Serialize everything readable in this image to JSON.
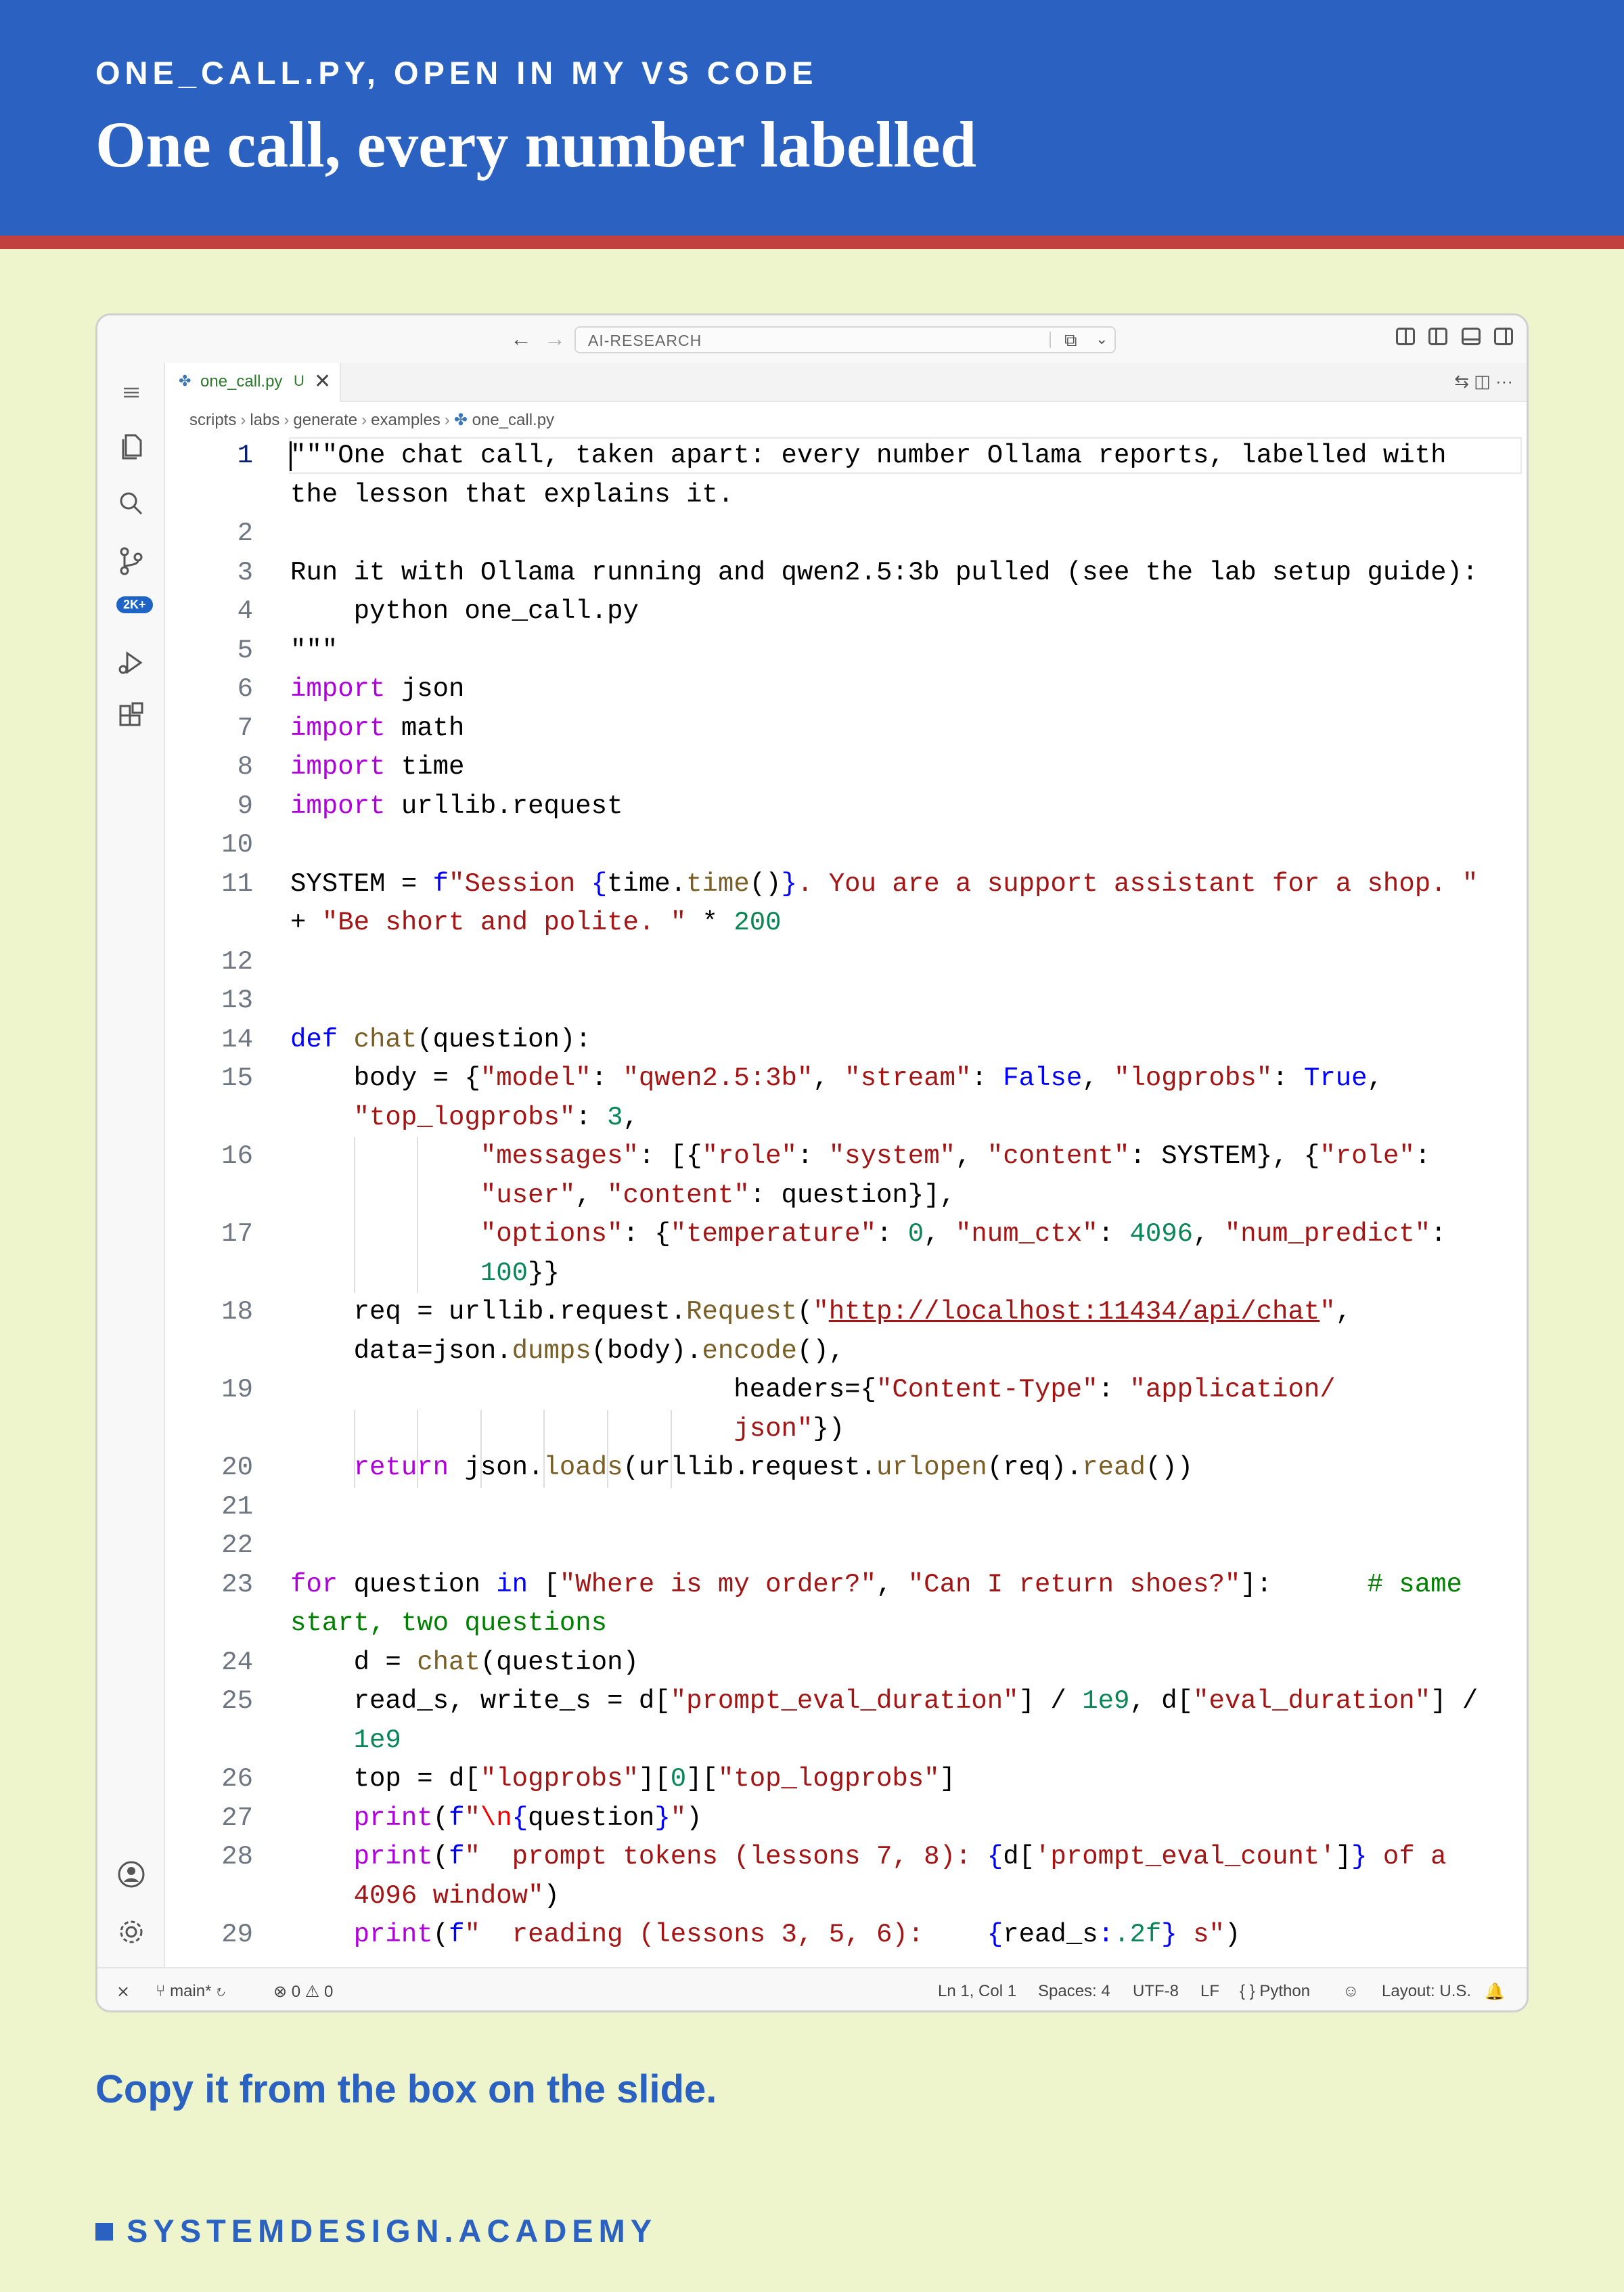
{
  "slide": {
    "kicker": "ONE_CALL.PY, OPEN IN MY VS CODE",
    "headline": "One call, every number labelled",
    "caption": "Copy it from the box on the slide.",
    "footer": "SYSTEMDESIGN.ACADEMY"
  },
  "titlebar": {
    "back": "←",
    "forward": "→",
    "search_text": "AI-RESEARCH",
    "chat": "⧉",
    "dropdown": "⌄"
  },
  "activity": {
    "scm_badge": "2K+"
  },
  "tab": {
    "file_icon": "✤",
    "name": "one_call.py",
    "modified": "U",
    "close": "✕",
    "actions": "⇆  ◫  ···"
  },
  "breadcrumb": [
    "scripts",
    "labs",
    "generate",
    "examples",
    "one_call.py"
  ],
  "breadcrumb_sep": "›",
  "code": {
    "line_numbers": [
      "1",
      "",
      "2",
      "3",
      "4",
      "5",
      "6",
      "7",
      "8",
      "9",
      "10",
      "11",
      "",
      "12",
      "13",
      "14",
      "15",
      "",
      "16",
      "",
      "17",
      "",
      "18",
      "",
      "19",
      "",
      "20",
      "21",
      "22",
      "23",
      "",
      "24",
      "25",
      "",
      "26",
      "27",
      "28",
      "",
      "29"
    ]
  },
  "status": {
    "remote": "⨯",
    "branch": "main*",
    "sync": "↻",
    "errors": "⊗ 0",
    "warnings": "⚠ 0",
    "position": "Ln 1, Col 1",
    "spaces": "Spaces: 4",
    "encoding": "UTF-8",
    "eol": "LF",
    "language": "{ } Python",
    "copilot": "☺",
    "layout": "Layout: U.S.",
    "bell": "🔔"
  }
}
